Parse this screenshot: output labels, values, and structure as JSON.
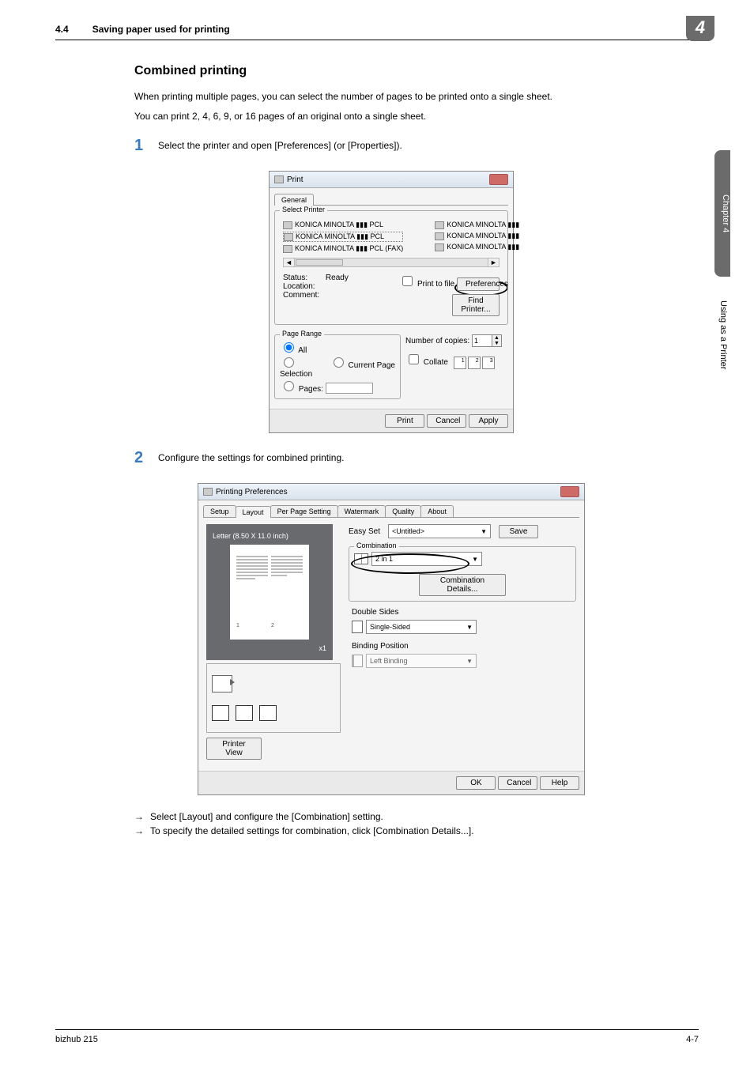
{
  "header": {
    "section_num": "4.4",
    "section_title": "Saving paper used for printing"
  },
  "chapter_badge": "4",
  "side_tab": "Chapter 4",
  "side_text": "Using as a Printer",
  "content": {
    "heading": "Combined printing",
    "para1": "When printing multiple pages, you can select the number of pages to be printed onto a single sheet.",
    "para2": "You can print 2, 4, 6, 9, or 16 pages of an original onto a single sheet.",
    "step1_num": "1",
    "step1_text": "Select the printer and open [Preferences] (or [Properties]).",
    "step2_num": "2",
    "step2_text": "Configure the settings for combined printing.",
    "bullet1": "Select [Layout] and configure the [Combination] setting.",
    "bullet2": "To specify the detailed settings for combination, click [Combination Details...]."
  },
  "dlg1": {
    "title": "Print",
    "tab_general": "General",
    "select_printer_legend": "Select Printer",
    "printers_left": [
      "KONICA MINOLTA ▮▮▮ PCL",
      "KONICA MINOLTA ▮▮▮ PCL",
      "KONICA MINOLTA ▮▮▮ PCL (FAX)"
    ],
    "printers_right": [
      "KONICA MINOLTA ▮▮▮",
      "KONICA MINOLTA ▮▮▮",
      "KONICA MINOLTA ▮▮▮"
    ],
    "status_label": "Status:",
    "status_value": "Ready",
    "location_label": "Location:",
    "comment_label": "Comment:",
    "print_to_file": "Print to file",
    "preferences": "Preferences",
    "find_printer": "Find Printer...",
    "page_range_legend": "Page Range",
    "pr_all": "All",
    "pr_selection": "Selection",
    "pr_current": "Current Page",
    "pr_pages": "Pages:",
    "copies_label": "Number of copies:",
    "copies_value": "1",
    "collate": "Collate",
    "btn_print": "Print",
    "btn_cancel": "Cancel",
    "btn_apply": "Apply"
  },
  "dlg2": {
    "title": "Printing Preferences",
    "tabs": [
      "Setup",
      "Layout",
      "Per Page Setting",
      "Watermark",
      "Quality",
      "About"
    ],
    "paper_label": "Letter (8.50 X 11.0 inch)",
    "scale": "x1",
    "printer_view": "Printer View",
    "easyset_label": "Easy Set",
    "easyset_value": "<Untitled>",
    "save": "Save",
    "combination_label": "Combination",
    "combination_value": "2 in 1",
    "combination_details": "Combination Details...",
    "double_sides_label": "Double Sides",
    "double_sides_value": "Single-Sided",
    "binding_label": "Binding Position",
    "binding_value": "Left Binding",
    "ok": "OK",
    "cancel": "Cancel",
    "help": "Help"
  },
  "footer": {
    "left": "bizhub 215",
    "right": "4-7"
  }
}
